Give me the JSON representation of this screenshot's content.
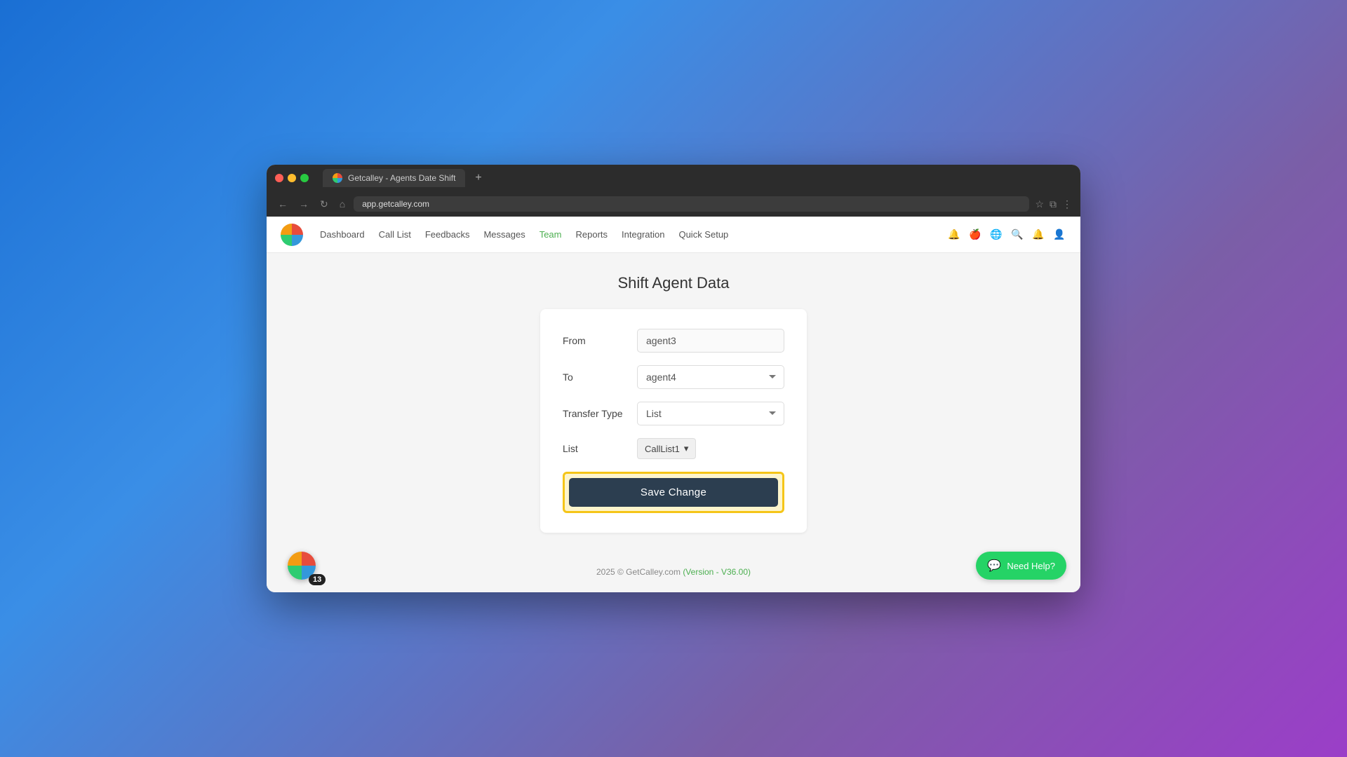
{
  "browser": {
    "tab_title": "Getcalley - Agents Date Shift",
    "tab_plus": "+",
    "address": "app.getcalley.com",
    "nav_back": "←",
    "nav_forward": "→",
    "nav_refresh": "↻",
    "nav_home": "⌂"
  },
  "navbar": {
    "links": [
      {
        "id": "dashboard",
        "label": "Dashboard",
        "active": false
      },
      {
        "id": "call-list",
        "label": "Call List",
        "active": false
      },
      {
        "id": "feedbacks",
        "label": "Feedbacks",
        "active": false
      },
      {
        "id": "messages",
        "label": "Messages",
        "active": false
      },
      {
        "id": "team",
        "label": "Team",
        "active": true
      },
      {
        "id": "reports",
        "label": "Reports",
        "active": false
      },
      {
        "id": "integration",
        "label": "Integration",
        "active": false
      },
      {
        "id": "quick-setup",
        "label": "Quick Setup",
        "active": false
      }
    ]
  },
  "page": {
    "title": "Shift Agent Data",
    "form": {
      "from_label": "From",
      "from_value": "agent3",
      "to_label": "To",
      "to_value": "agent4",
      "transfer_type_label": "Transfer Type",
      "transfer_type_value": "List",
      "list_label": "List",
      "list_value": "CallList1",
      "save_button_label": "Save Change"
    },
    "footer": {
      "text": "2025 © GetCalley.com ",
      "link": "(Version - V36.00)"
    }
  },
  "bottom": {
    "notification_count": "13",
    "need_help_label": "Need Help?"
  }
}
